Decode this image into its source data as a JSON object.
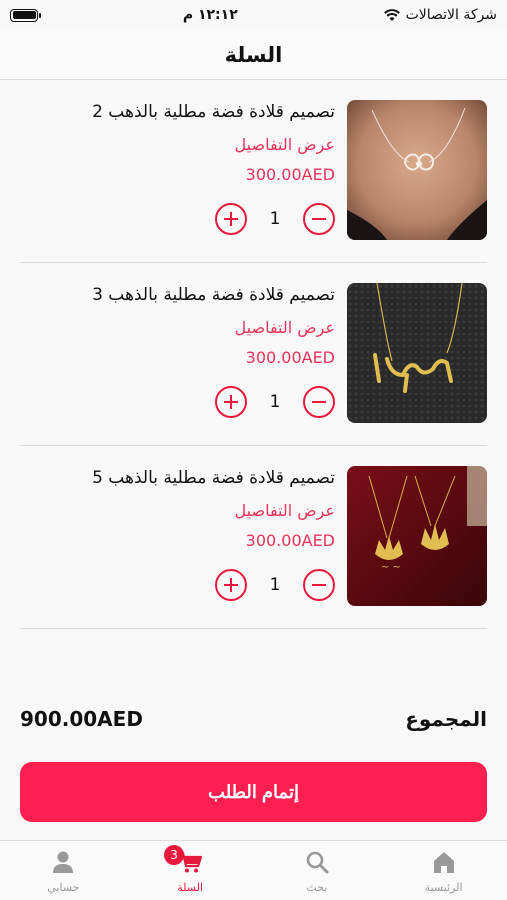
{
  "status_bar": {
    "carrier": "شركة الاتصالات",
    "time": "١٢:١٢ م"
  },
  "nav": {
    "title": "السلة"
  },
  "cart": {
    "details_label": "عرض التفاصيل",
    "items": [
      {
        "name": "تصميم قلادة فضة مطلية بالذهب 2",
        "price": "300.00AED",
        "quantity": "1",
        "image": "necklace-infinity-photo"
      },
      {
        "name": "تصميم قلادة فضة مطلية بالذهب 3",
        "price": "300.00AED",
        "quantity": "1",
        "image": "necklace-name-photo"
      },
      {
        "name": "تصميم قلادة فضة مطلية بالذهب 5",
        "price": "300.00AED",
        "quantity": "1",
        "image": "necklace-crowns-photo"
      }
    ]
  },
  "summary": {
    "total_label": "المجموع",
    "total_amount": "900.00AED"
  },
  "checkout": {
    "label": "إتمام الطلب",
    "color": "#fd1f4f"
  },
  "tab_bar": {
    "items": [
      {
        "label": "حسابي",
        "icon": "person-icon"
      },
      {
        "label": "السلة",
        "icon": "cart-icon",
        "badge": "3",
        "active": true
      },
      {
        "label": "بحث",
        "icon": "search-icon"
      },
      {
        "label": "الرئيسية",
        "icon": "home-icon"
      }
    ]
  },
  "colors": {
    "accent": "#e8193c",
    "price": "#e8335a"
  }
}
